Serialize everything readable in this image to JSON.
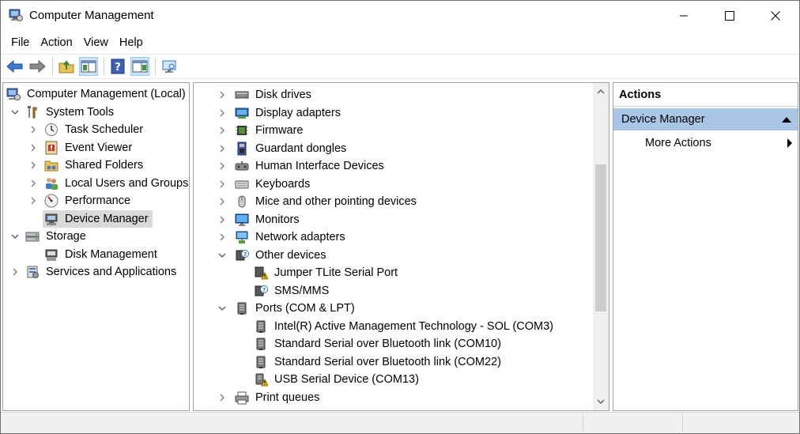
{
  "window": {
    "title": "Computer Management"
  },
  "menu": [
    "File",
    "Action",
    "View",
    "Help"
  ],
  "toolbar": {
    "icons": [
      "back-icon",
      "forward-icon",
      "up-folder-icon",
      "show-hide-console-tree-icon",
      "help-icon",
      "show-hide-action-pane-icon",
      "monitor-icon"
    ]
  },
  "left_tree": {
    "root": "Computer Management (Local)",
    "items": [
      {
        "label": "System Tools",
        "level": 1,
        "expander": "down",
        "icon": "tools-icon"
      },
      {
        "label": "Task Scheduler",
        "level": 2,
        "expander": "right",
        "icon": "clock-icon"
      },
      {
        "label": "Event Viewer",
        "level": 2,
        "expander": "right",
        "icon": "event-viewer-icon"
      },
      {
        "label": "Shared Folders",
        "level": 2,
        "expander": "right",
        "icon": "shared-folder-icon"
      },
      {
        "label": "Local Users and Groups",
        "level": 2,
        "expander": "right",
        "icon": "users-icon"
      },
      {
        "label": "Performance",
        "level": 2,
        "expander": "right",
        "icon": "performance-icon"
      },
      {
        "label": "Device Manager",
        "level": 2,
        "expander": "none",
        "icon": "device-manager-icon",
        "selected": true
      },
      {
        "label": "Storage",
        "level": 1,
        "expander": "down",
        "icon": "storage-icon"
      },
      {
        "label": "Disk Management",
        "level": 2,
        "expander": "none",
        "icon": "disk-management-icon"
      },
      {
        "label": "Services and Applications",
        "level": 1,
        "expander": "right",
        "icon": "services-icon"
      }
    ]
  },
  "device_tree": {
    "items": [
      {
        "label": "Disk drives",
        "level": 1,
        "expander": "right",
        "icon": "disk-drive-icon"
      },
      {
        "label": "Display adapters",
        "level": 1,
        "expander": "right",
        "icon": "display-adapter-icon"
      },
      {
        "label": "Firmware",
        "level": 1,
        "expander": "right",
        "icon": "firmware-icon"
      },
      {
        "label": "Guardant dongles",
        "level": 1,
        "expander": "right",
        "icon": "dongle-icon"
      },
      {
        "label": "Human Interface Devices",
        "level": 1,
        "expander": "right",
        "icon": "hid-icon"
      },
      {
        "label": "Keyboards",
        "level": 1,
        "expander": "right",
        "icon": "keyboard-icon"
      },
      {
        "label": "Mice and other pointing devices",
        "level": 1,
        "expander": "right",
        "icon": "mouse-icon"
      },
      {
        "label": "Monitors",
        "level": 1,
        "expander": "right",
        "icon": "monitor-icon"
      },
      {
        "label": "Network adapters",
        "level": 1,
        "expander": "right",
        "icon": "network-adapter-icon"
      },
      {
        "label": "Other devices",
        "level": 1,
        "expander": "down",
        "icon": "other-devices-icon"
      },
      {
        "label": "Jumper TLite Serial Port",
        "level": 2,
        "expander": "none",
        "icon": "warning-device-icon"
      },
      {
        "label": "SMS/MMS",
        "level": 2,
        "expander": "none",
        "icon": "unknown-device-icon"
      },
      {
        "label": "Ports (COM & LPT)",
        "level": 1,
        "expander": "down",
        "icon": "port-icon"
      },
      {
        "label": "Intel(R) Active Management Technology - SOL (COM3)",
        "level": 2,
        "expander": "none",
        "icon": "port-icon"
      },
      {
        "label": "Standard Serial over Bluetooth link (COM10)",
        "level": 2,
        "expander": "none",
        "icon": "port-icon"
      },
      {
        "label": "Standard Serial over Bluetooth link (COM22)",
        "level": 2,
        "expander": "none",
        "icon": "port-icon"
      },
      {
        "label": "USB Serial Device (COM13)",
        "level": 2,
        "expander": "none",
        "icon": "warning-port-icon"
      },
      {
        "label": "Print queues",
        "level": 1,
        "expander": "right",
        "icon": "printer-icon"
      }
    ]
  },
  "actions": {
    "header": "Actions",
    "group": "Device Manager",
    "more": "More Actions"
  },
  "colors": {
    "selection": "#d9d9d9",
    "actions_group_bg": "#a9c6e8",
    "arrow_blue": "#3a7bd5"
  }
}
